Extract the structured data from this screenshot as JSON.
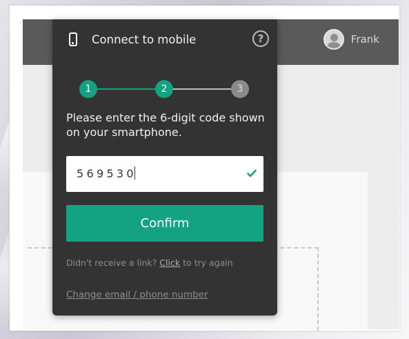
{
  "header": {
    "user_name": "Frank"
  },
  "popup": {
    "title": "Connect to mobile",
    "help_symbol": "?",
    "steps": [
      {
        "label": "1",
        "state": "complete"
      },
      {
        "label": "2",
        "state": "current"
      },
      {
        "label": "3",
        "state": "pending"
      }
    ],
    "instructions": "Please enter the 6-digit code shown on your smartphone.",
    "code_value": "569530",
    "confirm_label": "Confirm",
    "resend_prefix": "Didn't receive a link?",
    "resend_link": "Click",
    "resend_suffix": "to try again",
    "change_link": "Change email / phone number"
  },
  "colors": {
    "accent": "#13a382",
    "step_pending": "#8a8a8a",
    "popup_bg": "#333333",
    "header_bg": "#5a5a5a"
  },
  "icons": {
    "phone": "phone-icon",
    "help": "help-icon",
    "valid": "check-icon",
    "user": "avatar-icon"
  }
}
